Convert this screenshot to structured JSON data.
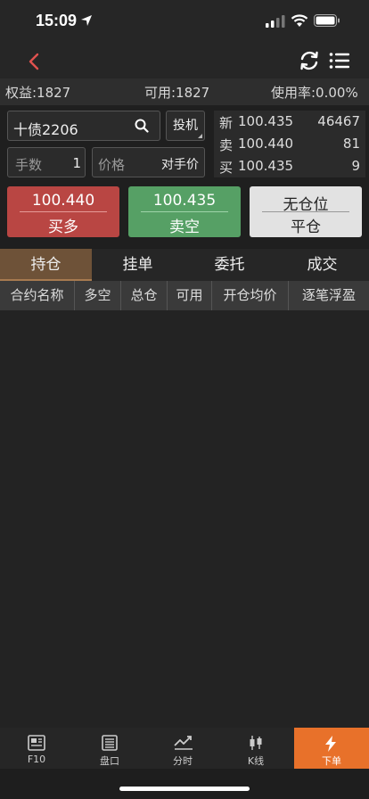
{
  "status_bar": {
    "time": "15:09"
  },
  "account": {
    "equity": "权益:1827",
    "available": "可用:1827",
    "usage": "使用率:0.00%"
  },
  "order": {
    "contract": "十债2206",
    "spec_button": "投机",
    "lots_label": "手数",
    "lots_value": "1",
    "price_label": "价格",
    "price_value": "对手价"
  },
  "quote": {
    "last": {
      "label": "新",
      "price": "100.435",
      "volume": "46467"
    },
    "ask": {
      "label": "卖",
      "price": "100.440",
      "volume": "81"
    },
    "bid": {
      "label": "买",
      "price": "100.435",
      "volume": "9"
    }
  },
  "actions": {
    "buy": {
      "price": "100.440",
      "label": "买多"
    },
    "sell": {
      "price": "100.435",
      "label": "卖空"
    },
    "close": {
      "status": "无仓位",
      "label": "平仓"
    }
  },
  "tabs": [
    "持仓",
    "挂单",
    "委托",
    "成交"
  ],
  "columns": [
    "合约名称",
    "多空",
    "总仓",
    "可用",
    "开仓均价",
    "逐笔浮盈"
  ],
  "bottom_nav": [
    {
      "label": "F10",
      "icon": "f10-icon"
    },
    {
      "label": "盘口",
      "icon": "orderbook-icon"
    },
    {
      "label": "分时",
      "icon": "timeshare-icon"
    },
    {
      "label": "K线",
      "icon": "candlestick-icon"
    },
    {
      "label": "下单",
      "icon": "lightning-icon"
    }
  ],
  "colors": {
    "buy": "#b94643",
    "sell": "#56a065",
    "active_tab": "#6e5238",
    "active_nav": "#e8712a",
    "back_arrow": "#e0524f"
  }
}
